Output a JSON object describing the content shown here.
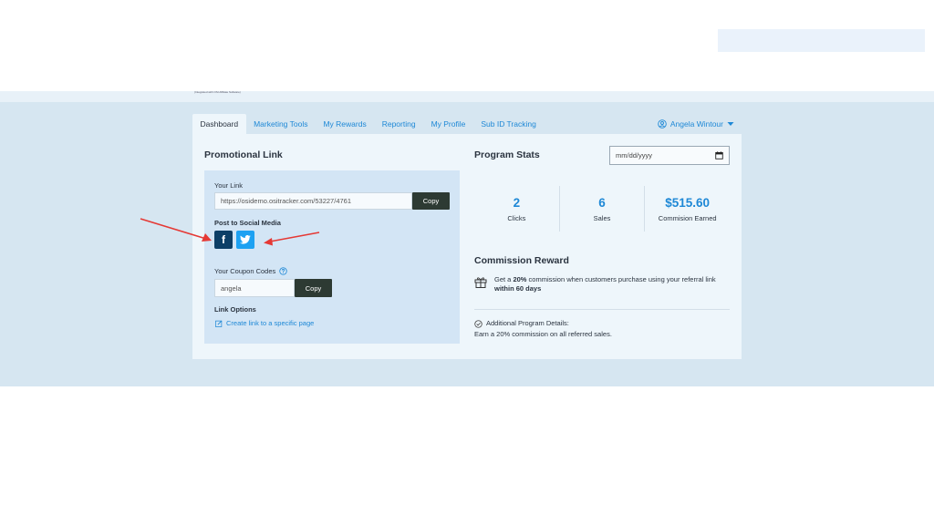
{
  "header": {
    "tiny_text": "(Integrated with OSI Affiliate Software)"
  },
  "tabs": [
    {
      "label": "Dashboard",
      "active": true
    },
    {
      "label": "Marketing Tools"
    },
    {
      "label": "My Rewards"
    },
    {
      "label": "Reporting"
    },
    {
      "label": "My Profile"
    },
    {
      "label": "Sub ID Tracking"
    }
  ],
  "user": {
    "name": "Angela Wintour",
    "icon": "user-circle-icon"
  },
  "promo": {
    "title": "Promotional Link",
    "your_link_label": "Your Link",
    "link_value": "https://osidemo.ositracker.com/53227/4761",
    "copy_label": "Copy",
    "social_label": "Post to Social Media",
    "facebook_glyph": "f",
    "coupon_label": "Your Coupon Codes",
    "coupon_value": "angela",
    "coupon_copy_label": "Copy",
    "link_options_label": "Link Options",
    "create_link_label": "Create link to a specific page"
  },
  "stats": {
    "title": "Program Stats",
    "date_placeholder": "mm/dd/yyyy",
    "items": [
      {
        "value": "2",
        "label": "Clicks"
      },
      {
        "value": "6",
        "label": "Sales"
      },
      {
        "value": "$515.60",
        "label": "Commision Earned"
      }
    ]
  },
  "reward": {
    "title": "Commission Reward",
    "text_pre": "Get a ",
    "text_bold1": "20%",
    "text_mid": " commission when customers purchase using your referral link ",
    "text_bold2": "within 60 days"
  },
  "details": {
    "label": "Additional Program Details:",
    "text": "Earn a 20% commission on all referred sales."
  },
  "colors": {
    "accent": "#1e88d6",
    "band": "#d6e6f1",
    "arrow": "#e53935",
    "button": "#2d3a33"
  }
}
